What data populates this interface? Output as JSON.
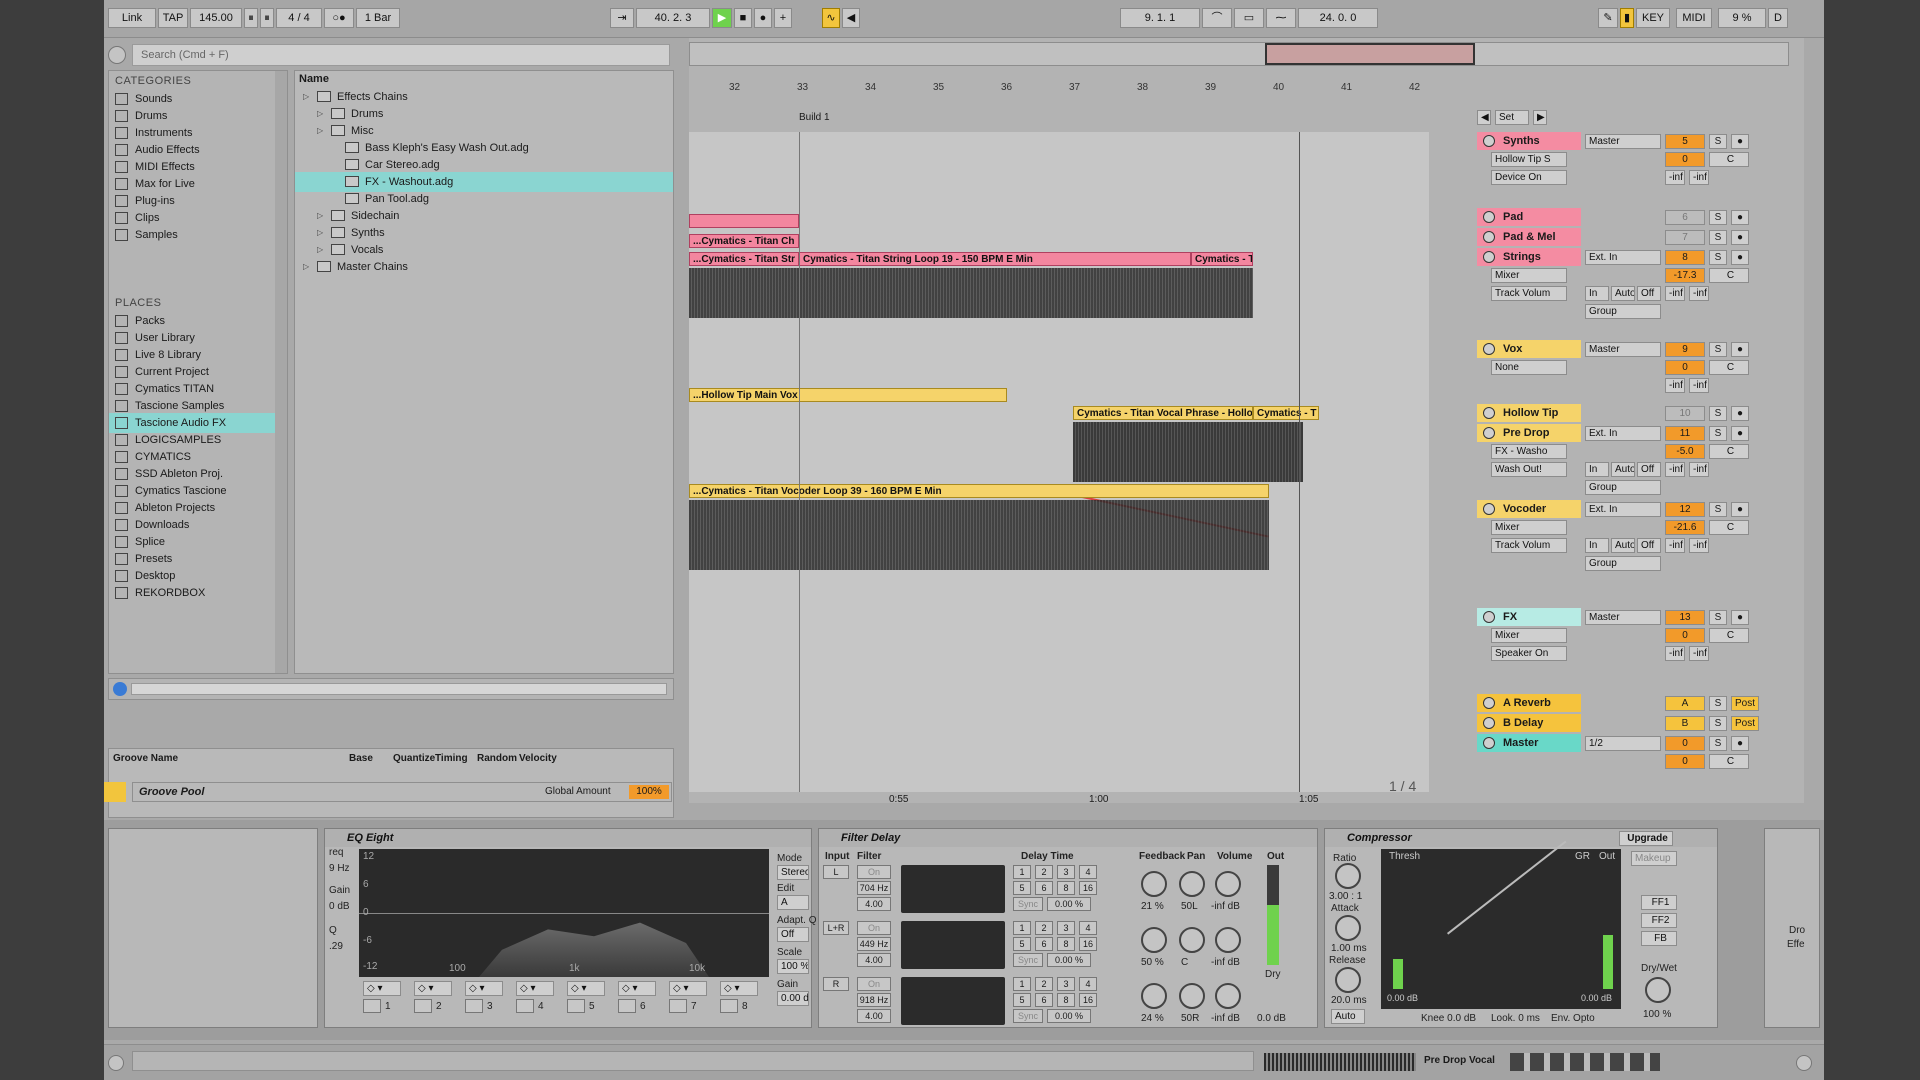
{
  "control_bar": {
    "link": "Link",
    "tap": "TAP",
    "tempo": "145.00",
    "time_sig": "4 / 4",
    "quantize": "1 Bar",
    "position": "40.  2.  3",
    "loop_start": "9.  1.  1",
    "loop_length": "24.  0.  0",
    "key": "KEY",
    "midi": "MIDI",
    "cpu": "9 %",
    "d": "D"
  },
  "browser": {
    "search_placeholder": "Search (Cmd + F)",
    "categories_title": "CATEGORIES",
    "categories": [
      "Sounds",
      "Drums",
      "Instruments",
      "Audio Effects",
      "MIDI Effects",
      "Max for Live",
      "Plug-ins",
      "Clips",
      "Samples"
    ],
    "places_title": "PLACES",
    "places": [
      "Packs",
      "User Library",
      "Live 8 Library",
      "Current Project",
      "Cymatics TITAN",
      "Tascione Samples",
      "Tascione Audio FX",
      "LOGICSAMPLES",
      "CYMATICS",
      "SSD Ableton Proj.",
      "Cymatics Tascione",
      "Ableton Projects",
      "Downloads",
      "Splice",
      "Presets",
      "Desktop",
      "REKORDBOX"
    ],
    "selected_place": "Tascione Audio FX",
    "name_header": "Name",
    "files": [
      {
        "label": "Effects Chains",
        "indent": 0,
        "type": "folder"
      },
      {
        "label": "Drums",
        "indent": 1,
        "type": "folder"
      },
      {
        "label": "Misc",
        "indent": 1,
        "type": "folder"
      },
      {
        "label": "Bass Kleph's Easy Wash Out.adg",
        "indent": 2,
        "type": "file"
      },
      {
        "label": "Car Stereo.adg",
        "indent": 2,
        "type": "file"
      },
      {
        "label": "FX - Washout.adg",
        "indent": 2,
        "type": "file",
        "selected": true
      },
      {
        "label": "Pan Tool.adg",
        "indent": 2,
        "type": "file"
      },
      {
        "label": "Sidechain",
        "indent": 1,
        "type": "folder"
      },
      {
        "label": "Synths",
        "indent": 1,
        "type": "folder"
      },
      {
        "label": "Vocals",
        "indent": 1,
        "type": "folder"
      },
      {
        "label": "Master Chains",
        "indent": 0,
        "type": "folder"
      }
    ],
    "groove_headers": [
      "Groove Name",
      "Base",
      "Quantize",
      "Timing",
      "Random",
      "Velocity"
    ],
    "groove_pool": "Groove Pool",
    "global_amount_label": "Global Amount",
    "global_amount": "100%"
  },
  "arrangement": {
    "ruler": [
      "32",
      "33",
      "34",
      "35",
      "36",
      "37",
      "38",
      "39",
      "40",
      "41",
      "42"
    ],
    "locator": "Build 1",
    "set_label": "Set",
    "time_ruler": [
      "0:55",
      "1:00",
      "1:05"
    ],
    "zoom": "1 / 4",
    "clips": {
      "titan_ch": "...Cymatics - Titan Ch",
      "titan_str": "...Cymatics - Titan Str",
      "string_loop": "Cymatics - Titan String Loop 19 - 150 BPM E Min",
      "cymatics_t1": "Cymatics - T",
      "hollow_vox": "...Hollow Tip Main Vox",
      "vocal_phrase": "Cymatics - Titan Vocal Phrase - Hollow",
      "cymatics_t2": "Cymatics - T",
      "vocoder_loop": "...Cymatics - Titan Vocoder Loop 39 - 160 BPM E Min"
    }
  },
  "mixer": {
    "tracks": [
      {
        "name": "Synths",
        "color": "#f48ca2",
        "out": "Master",
        "num": "5",
        "vol": "0",
        "sub1": "Hollow Tip S",
        "sub2": "Device On"
      },
      {
        "name": "Pad",
        "color": "#f48ca2",
        "num": "6"
      },
      {
        "name": "Pad & Mel",
        "color": "#f48ca2",
        "num": "7"
      },
      {
        "name": "Strings",
        "color": "#f48ca2",
        "out": "Ext. In",
        "num": "8",
        "vol": "-17.3",
        "sub1": "Mixer",
        "sub2": "Track Volum",
        "group": "Group"
      },
      {
        "name": "Vox",
        "color": "#f5d36a",
        "out": "Master",
        "num": "9",
        "vol": "0",
        "sub1": "None"
      },
      {
        "name": "Hollow Tip",
        "color": "#f5d36a",
        "num": "10"
      },
      {
        "name": "Pre Drop",
        "color": "#f5d36a",
        "out": "Ext. In",
        "num": "11",
        "vol": "-5.0",
        "sub1": "FX - Washo",
        "sub2": "Wash Out!",
        "group": "Group"
      },
      {
        "name": "Vocoder",
        "color": "#f5d36a",
        "out": "Ext. In",
        "num": "12",
        "vol": "-21.6",
        "sub1": "Mixer",
        "sub2": "Track Volum",
        "group": "Group"
      },
      {
        "name": "FX",
        "color": "#b7ebe4",
        "out": "Master",
        "num": "13",
        "vol": "0",
        "sub1": "Mixer",
        "sub2": "Speaker On"
      },
      {
        "name": "A Reverb",
        "color": "#f5c33d",
        "num": "A",
        "post": "Post"
      },
      {
        "name": "B Delay",
        "color": "#f5c33d",
        "num": "B",
        "post": "Post"
      },
      {
        "name": "Master",
        "color": "#69d8c8",
        "out": "1/2",
        "num": "0",
        "vol": "0"
      }
    ],
    "inf": "-inf",
    "c": "C",
    "s": "S",
    "in": "In",
    "auto": "Auto",
    "off": "Off"
  },
  "devices": {
    "eq": {
      "title": "EQ Eight",
      "mode_label": "Mode",
      "mode": "Stereo",
      "edit": "Edit",
      "edit_val": "A",
      "adapt_q": "Adapt. Q",
      "adapt_val": "Off",
      "scale_label": "Scale",
      "scale": "100 %",
      "gain_label": "Gain",
      "gain": "0.00 dB",
      "freq_axis": [
        "100",
        "1k",
        "10k"
      ],
      "db_axis": [
        "12",
        "6",
        "0",
        "-6",
        "-12"
      ],
      "side_labels": [
        "req",
        "9 Hz",
        "Gain",
        "0 dB",
        "Q",
        ".29"
      ],
      "bands": [
        "1",
        "2",
        "3",
        "4",
        "5",
        "6",
        "7",
        "8"
      ]
    },
    "delay": {
      "title": "Filter Delay",
      "input": "Input",
      "filter": "Filter",
      "delay_time": "Delay Time",
      "feedback": "Feedback",
      "pan": "Pan",
      "volume": "Volume",
      "out": "Out",
      "dry": "Dry",
      "dry_val": "0.0 dB",
      "rows": [
        {
          "ch": "L",
          "on": "On",
          "freq": "704 Hz",
          "q": "4.00",
          "fb": "21 %",
          "pan": "50L",
          "vol": "-inf dB",
          "pct": "0.00 %"
        },
        {
          "ch": "L+R",
          "on": "On",
          "freq": "449 Hz",
          "q": "4.00",
          "fb": "50 %",
          "pan": "C",
          "vol": "-inf dB",
          "pct": "0.00 %"
        },
        {
          "ch": "R",
          "on": "On",
          "freq": "918 Hz",
          "q": "4.00",
          "fb": "24 %",
          "pan": "50R",
          "vol": "-inf dB",
          "pct": "0.00 %"
        }
      ],
      "sync": "Sync",
      "steps": [
        "1",
        "2",
        "3",
        "4",
        "5",
        "6",
        "8",
        "16"
      ]
    },
    "comp": {
      "title": "Compressor",
      "upgrade": "Upgrade",
      "ratio_label": "Ratio",
      "ratio": "3.00 : 1",
      "attack_label": "Attack",
      "attack": "1.00 ms",
      "release_label": "Release",
      "release": "20.0 ms",
      "auto": "Auto",
      "thresh": "Thresh",
      "gr": "GR",
      "out": "Out",
      "thresh_val": "0.00 dB",
      "out_val": "0.00 dB",
      "knee": "Knee 0.0 dB",
      "look": "Look. 0 ms",
      "env": "Env. Opto",
      "makeup": "Makeup",
      "ff1": "FF1",
      "ff2": "FF2",
      "fb": "FB",
      "drywet": "Dry/Wet",
      "drywet_val": "100 %"
    },
    "right_labels": [
      "Dro",
      "Effe"
    ]
  },
  "status": {
    "track_name": "Pre Drop Vocal"
  }
}
